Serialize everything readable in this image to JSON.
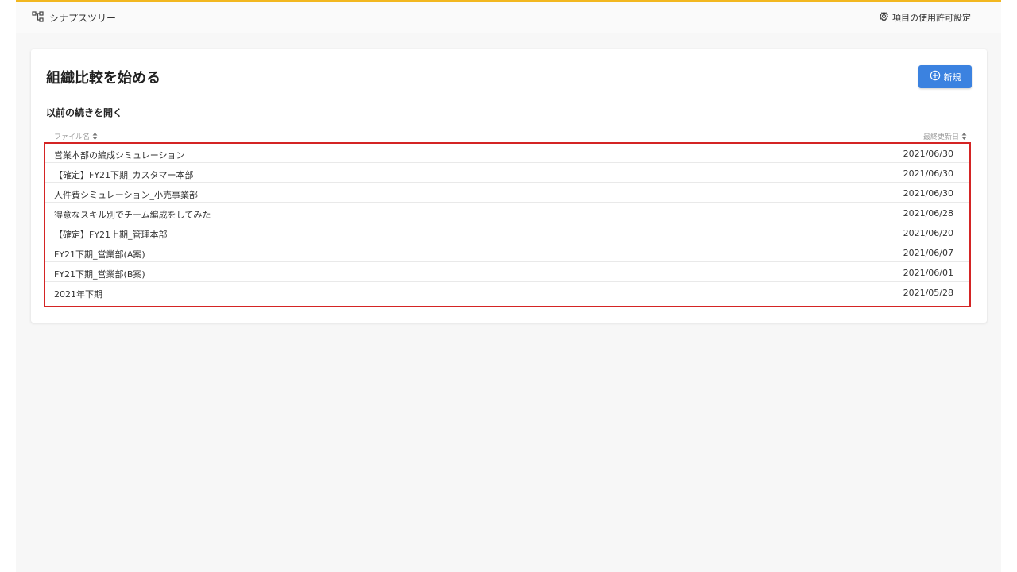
{
  "header": {
    "app_name": "シナプスツリー",
    "permission_settings": "項目の使用許可設定"
  },
  "page": {
    "title": "組織比較を始める",
    "new_button": "新規",
    "subtitle": "以前の続きを開く"
  },
  "table": {
    "columns": [
      "ファイル名",
      "最終更新日"
    ],
    "rows": [
      {
        "name": "営業本部の編成シミュレーション",
        "date": "2021/06/30"
      },
      {
        "name": "【確定】FY21下期_カスタマー本部",
        "date": "2021/06/30"
      },
      {
        "name": "人件費シミュレーション_小売事業部",
        "date": "2021/06/30"
      },
      {
        "name": "得意なスキル別でチーム編成をしてみた",
        "date": "2021/06/28"
      },
      {
        "name": "【確定】FY21上期_管理本部",
        "date": "2021/06/20"
      },
      {
        "name": "FY21下期_営業部(A案)",
        "date": "2021/06/07"
      },
      {
        "name": "FY21下期_営業部(B案)",
        "date": "2021/06/01"
      },
      {
        "name": "2021年下期",
        "date": "2021/05/28"
      }
    ]
  },
  "colors": {
    "accent": "#3b82e0",
    "top_bar": "#f2b71f",
    "highlight_border": "#d42424"
  }
}
